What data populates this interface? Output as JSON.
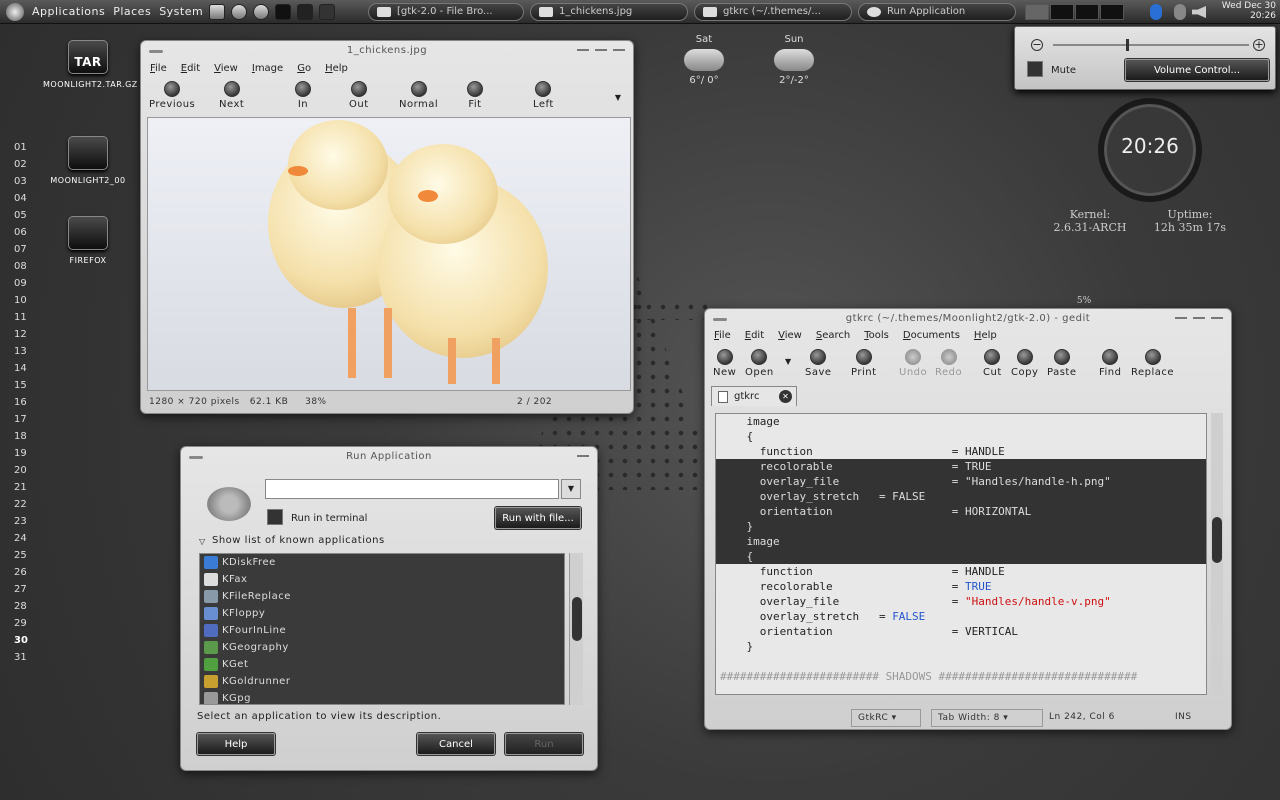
{
  "panel": {
    "menus": [
      "Applications",
      "Places",
      "System"
    ],
    "tasks": [
      "[gtk-2.0 - File Bro...",
      "1_chickens.jpg",
      "gtkrc (~/.themes/...",
      "Run Application"
    ],
    "clock_line1": "Wed Dec 30",
    "clock_line2": "20:26"
  },
  "desktop": {
    "icons": [
      {
        "label": "MOONLIGHT2.TAR.GZ",
        "badge": "TAR"
      },
      {
        "label": "MOONLIGHT2_00",
        "badge": ""
      },
      {
        "label": "FIREFOX",
        "badge": ""
      }
    ],
    "day_numbers": [
      "01",
      "02",
      "03",
      "04",
      "05",
      "06",
      "07",
      "08",
      "09",
      "10",
      "11",
      "12",
      "13",
      "14",
      "15",
      "16",
      "17",
      "18",
      "19",
      "20",
      "21",
      "22",
      "23",
      "24",
      "25",
      "26",
      "27",
      "28",
      "29",
      "30",
      "31"
    ],
    "today": "30",
    "weather": [
      {
        "day": "Sat",
        "temp": "6°/ 0°"
      },
      {
        "day": "Sun",
        "temp": "2°/-2°"
      }
    ]
  },
  "image_viewer": {
    "title": "1_chickens.jpg",
    "menu": [
      "File",
      "Edit",
      "View",
      "Image",
      "Go",
      "Help"
    ],
    "tools": [
      "Previous",
      "Next",
      "In",
      "Out",
      "Normal",
      "Fit",
      "Left"
    ],
    "status_size": "1280 × 720 pixels",
    "status_file": "62.1 KB",
    "status_zoom": "38%",
    "status_count": "2 / 202"
  },
  "run_dialog": {
    "title": "Run Application",
    "command_value": "",
    "terminal_label": "Run in terminal",
    "run_with_file": "Run with file...",
    "show_list": "Show list of known applications",
    "apps": [
      "KDiskFree",
      "KFax",
      "KFileReplace",
      "KFloppy",
      "KFourInLine",
      "KGeography",
      "KGet",
      "KGoldrunner",
      "KGpg"
    ],
    "description": "Select an application to view its description.",
    "help": "Help",
    "cancel": "Cancel",
    "run": "Run"
  },
  "gedit": {
    "title": "gtkrc (~/.themes/Moonlight2/gtk-2.0) - gedit",
    "menu": [
      "File",
      "Edit",
      "View",
      "Search",
      "Tools",
      "Documents",
      "Help"
    ],
    "tools": [
      "New",
      "Open",
      "Save",
      "Print",
      "Undo",
      "Redo",
      "Cut",
      "Copy",
      "Paste",
      "Find",
      "Replace"
    ],
    "tab": "gtkrc",
    "lines": [
      "    image",
      "    {",
      "      function                     = HANDLE",
      "      recolorable                  = TRUE",
      "      overlay_file                 = \"Handles/handle-h.png\"",
      "      overlay_stretch   = FALSE",
      "      orientation                  = HORIZONTAL",
      "    }",
      "    image",
      "    {",
      "      function                     = HANDLE",
      "      recolorable                  = TRUE",
      "      overlay_file                 = \"Handles/handle-v.png\"",
      "      overlay_stretch   = FALSE",
      "      orientation                  = VERTICAL",
      "    }",
      "",
      "######################## SHADOWS ##############################"
    ],
    "status_lang": "GtkRC",
    "status_tab": "Tab Width: 8",
    "status_pos": "Ln 242, Col 6",
    "status_ins": "INS"
  },
  "volume": {
    "mute": "Mute",
    "control": "Volume Control...",
    "level": 0.37
  },
  "conky": {
    "time": "20:26",
    "kernel_label": "Kernel:",
    "kernel": "2.6.31-ARCH",
    "uptime_label": "Uptime:",
    "uptime": "12h 35m 17s",
    "cpu": "5%"
  }
}
